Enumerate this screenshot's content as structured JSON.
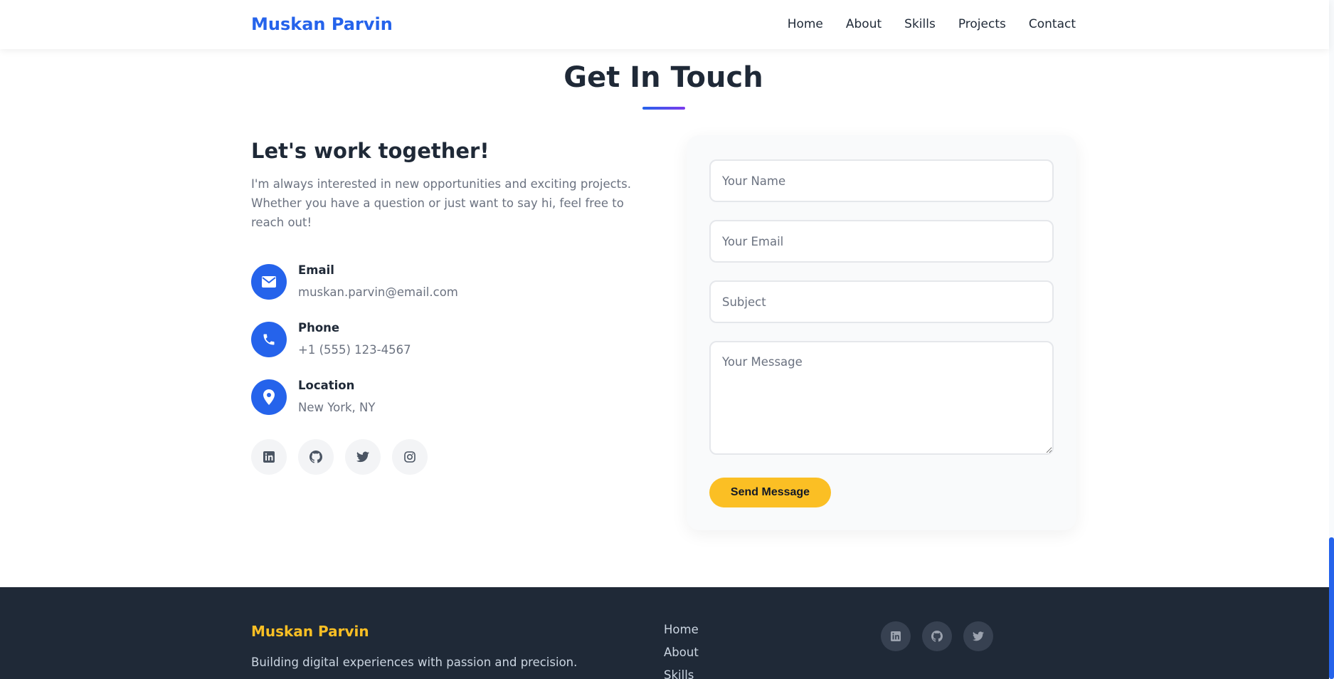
{
  "header": {
    "brand": "Muskan Parvin",
    "nav": [
      "Home",
      "About",
      "Skills",
      "Projects",
      "Contact"
    ]
  },
  "contact": {
    "title": "Get In Touch",
    "lead_title": "Let's work together!",
    "lead_text": "I'm always interested in new opportunities and exciting projects. Whether you have a question or just want to say hi, feel free to reach out!",
    "items": [
      {
        "label": "Email",
        "value": "muskan.parvin@email.com",
        "icon": "envelope-icon"
      },
      {
        "label": "Phone",
        "value": "+1 (555) 123-4567",
        "icon": "phone-icon"
      },
      {
        "label": "Location",
        "value": "New York, NY",
        "icon": "map-pin-icon"
      }
    ],
    "socials": [
      "linkedin-icon",
      "github-icon",
      "twitter-icon",
      "instagram-icon"
    ]
  },
  "form": {
    "name_placeholder": "Your Name",
    "email_placeholder": "Your Email",
    "subject_placeholder": "Subject",
    "message_placeholder": "Your Message",
    "submit_label": "Send Message"
  },
  "footer": {
    "brand": "Muskan Parvin",
    "tagline": "Building digital experiences with passion and precision.",
    "links": [
      "Home",
      "About",
      "Skills"
    ],
    "socials": [
      "linkedin-icon",
      "github-icon",
      "twitter-icon"
    ]
  },
  "colors": {
    "primary": "#2563eb",
    "accent": "#fbbf24",
    "footer_bg": "#1f2937"
  }
}
